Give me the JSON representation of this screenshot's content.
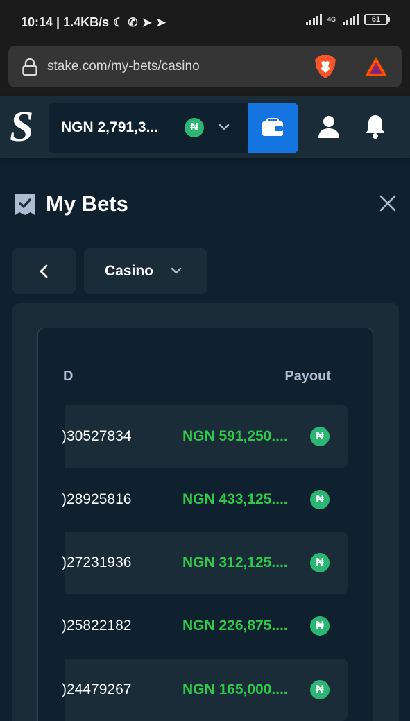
{
  "status_bar": {
    "left_text": "10:14 | 1.4KB/s",
    "network_label": "4G",
    "battery": "61"
  },
  "browser": {
    "url": "stake.com/my-bets/casino"
  },
  "header": {
    "logo": "S",
    "balance": "NGN 2,791,3...",
    "currency_symbol": "₦"
  },
  "page": {
    "title": "My Bets",
    "filter_label": "Casino"
  },
  "table": {
    "columns": [
      "D",
      "Payout"
    ],
    "rows": [
      {
        "id": ")30527834",
        "payout": "NGN 591,250....",
        "currency_symbol": "₦"
      },
      {
        "id": ")28925816",
        "payout": "NGN 433,125....",
        "currency_symbol": "₦"
      },
      {
        "id": ")27231936",
        "payout": "NGN 312,125....",
        "currency_symbol": "₦"
      },
      {
        "id": ")25822182",
        "payout": "NGN 226,875....",
        "currency_symbol": "₦"
      },
      {
        "id": ")24479267",
        "payout": "NGN 165,000....",
        "currency_symbol": "₦"
      }
    ]
  },
  "colors": {
    "accent_blue": "#1475e1",
    "payout_green": "#2ec94a",
    "naira_badge": "#2bb673",
    "background": "#0f212e",
    "surface": "#1a2c38"
  }
}
